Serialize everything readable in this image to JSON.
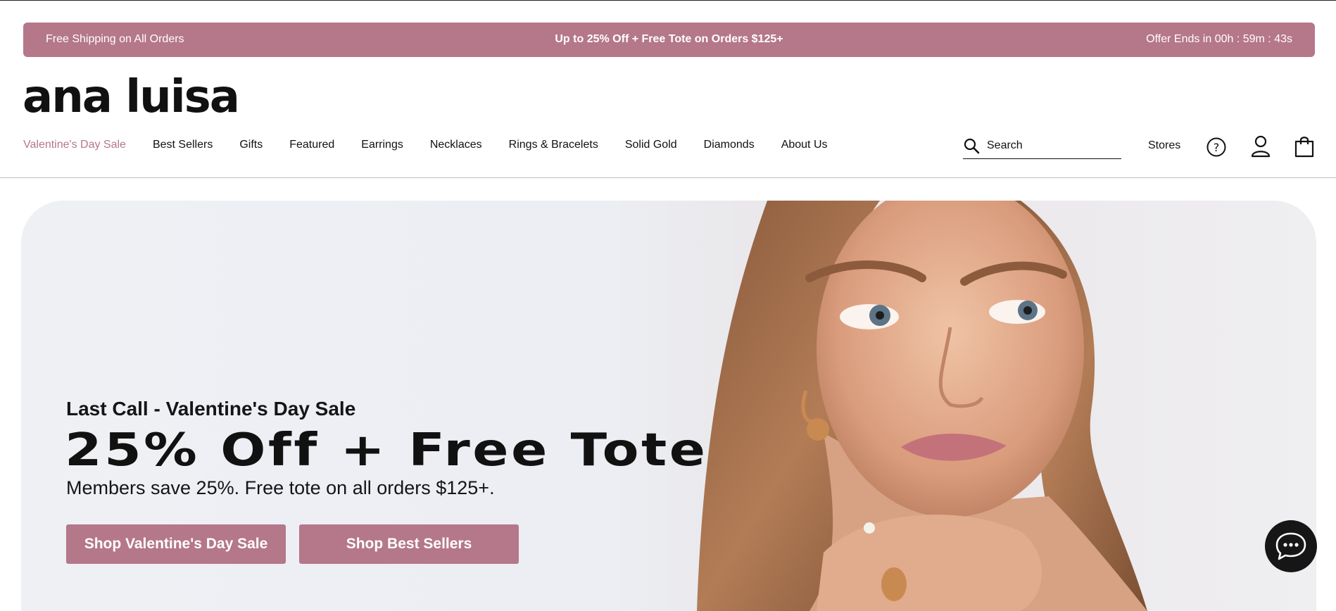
{
  "promo": {
    "left": "Free Shipping on All Orders",
    "center": "Up to 25% Off + Free Tote on Orders $125+",
    "right": "Offer Ends in 00h : 59m : 43s"
  },
  "logo": "ana luisa",
  "nav": {
    "items": [
      {
        "label": "Valentine's Day Sale"
      },
      {
        "label": "Best Sellers"
      },
      {
        "label": "Gifts"
      },
      {
        "label": "Featured"
      },
      {
        "label": "Earrings"
      },
      {
        "label": "Necklaces"
      },
      {
        "label": "Rings & Bracelets"
      },
      {
        "label": "Solid Gold"
      },
      {
        "label": "Diamonds"
      },
      {
        "label": "About Us"
      }
    ]
  },
  "search": {
    "placeholder": "Search"
  },
  "header": {
    "stores_label": "Stores"
  },
  "hero": {
    "eyebrow": "Last Call - Valentine's Day Sale",
    "title": "25% Off + Free Tote",
    "subtitle": "Members save 25%. Free tote on all orders $125+.",
    "primary_button": "Shop Valentine's Day Sale",
    "secondary_button": "Shop Best Sellers"
  },
  "icons": {
    "search": "search-icon",
    "help": "help-icon",
    "account": "user-icon",
    "cart": "shopping-bag-icon",
    "chat": "chat-icon"
  },
  "colors": {
    "accent": "#b5778a",
    "text": "#111111",
    "chat_bg": "#161616"
  }
}
